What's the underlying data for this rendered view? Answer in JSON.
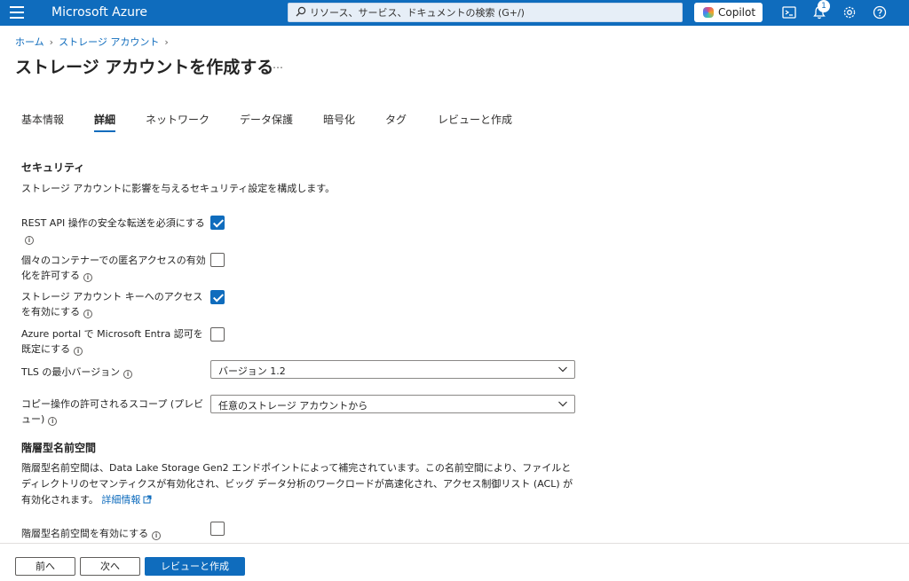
{
  "header": {
    "brand": "Microsoft Azure",
    "search_placeholder": "リソース、サービス、ドキュメントの検索 (G+/)",
    "copilot_label": "Copilot",
    "notification_count": "1"
  },
  "breadcrumb": {
    "home": "ホーム",
    "storage": "ストレージ アカウント"
  },
  "page": {
    "title": "ストレージ アカウントを作成する",
    "more": "…"
  },
  "tabs": [
    "基本情報",
    "詳細",
    "ネットワーク",
    "データ保護",
    "暗号化",
    "タグ",
    "レビューと作成"
  ],
  "active_tab": "詳細",
  "security": {
    "title": "セキュリティ",
    "description": "ストレージ アカウントに影響を与えるセキュリティ設定を構成します。",
    "rest_api_label": "REST API 操作の安全な転送を必須にする",
    "rest_api_checked": true,
    "anonymous_label": "個々のコンテナーでの匿名アクセスの有効化を許可する",
    "anonymous_checked": false,
    "account_key_label": "ストレージ アカウント キーへのアクセスを有効にする",
    "account_key_checked": true,
    "entra_label": "Azure portal で Microsoft Entra 認可を既定にする",
    "entra_checked": false,
    "tls_label": "TLS の最小バージョン",
    "tls_value": "バージョン 1.2",
    "copy_scope_label": "コピー操作の許可されるスコープ (プレビュー)",
    "copy_scope_value": "任意のストレージ アカウントから"
  },
  "hns": {
    "title": "階層型名前空間",
    "description": "階層型名前空間は、Data Lake Storage Gen2 エンドポイントによって補完されています。この名前空間により、ファイルとディレクトリのセマンティクスが有効化され、ビッグ データ分析のワークロードが高速化され、アクセス制御リスト (ACL) が有効化されます。",
    "learn_more": "詳細情報",
    "enable_label": "階層型名前空間を有効にする",
    "enable_checked": false
  },
  "footer": {
    "prev": "前へ",
    "next": "次へ",
    "review": "レビューと作成"
  }
}
